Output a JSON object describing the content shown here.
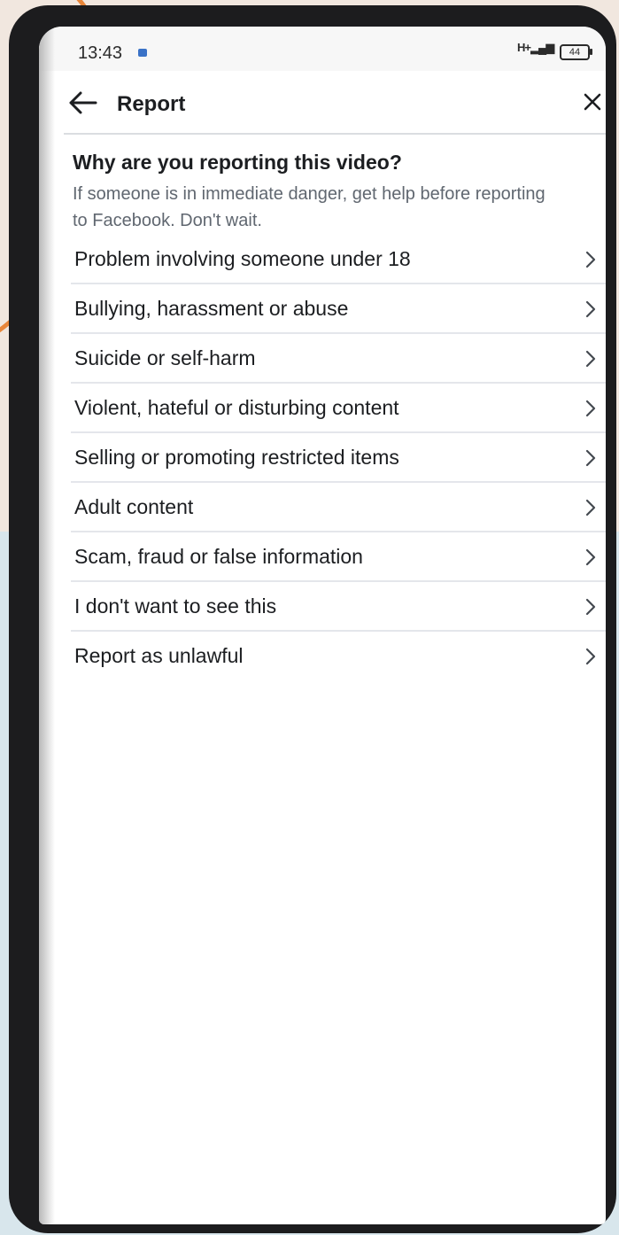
{
  "status_bar": {
    "time": "13:43",
    "signal": "H+",
    "battery": "44"
  },
  "header": {
    "title": "Report",
    "back_icon": "arrow-left-icon",
    "close_icon": "close-icon"
  },
  "question": {
    "title": "Why are you reporting this video?",
    "subtitle": "If someone is in immediate danger, get help before reporting to Facebook. Don't wait."
  },
  "options": [
    {
      "label": "Problem involving someone under 18"
    },
    {
      "label": "Bullying, harassment or abuse"
    },
    {
      "label": "Suicide or self-harm"
    },
    {
      "label": "Violent, hateful or disturbing content"
    },
    {
      "label": "Selling or promoting restricted items"
    },
    {
      "label": "Adult content"
    },
    {
      "label": "Scam, fraud or false information"
    },
    {
      "label": "I don't want to see this"
    },
    {
      "label": "Report as unlawful"
    }
  ],
  "colors": {
    "background_warm": "#f1e7df",
    "background_cool": "#d8e6ec",
    "accent_orange": "#e8863a",
    "phone_frame": "#1c1c1e",
    "text_primary": "#1c1e21",
    "text_secondary": "#606770"
  }
}
